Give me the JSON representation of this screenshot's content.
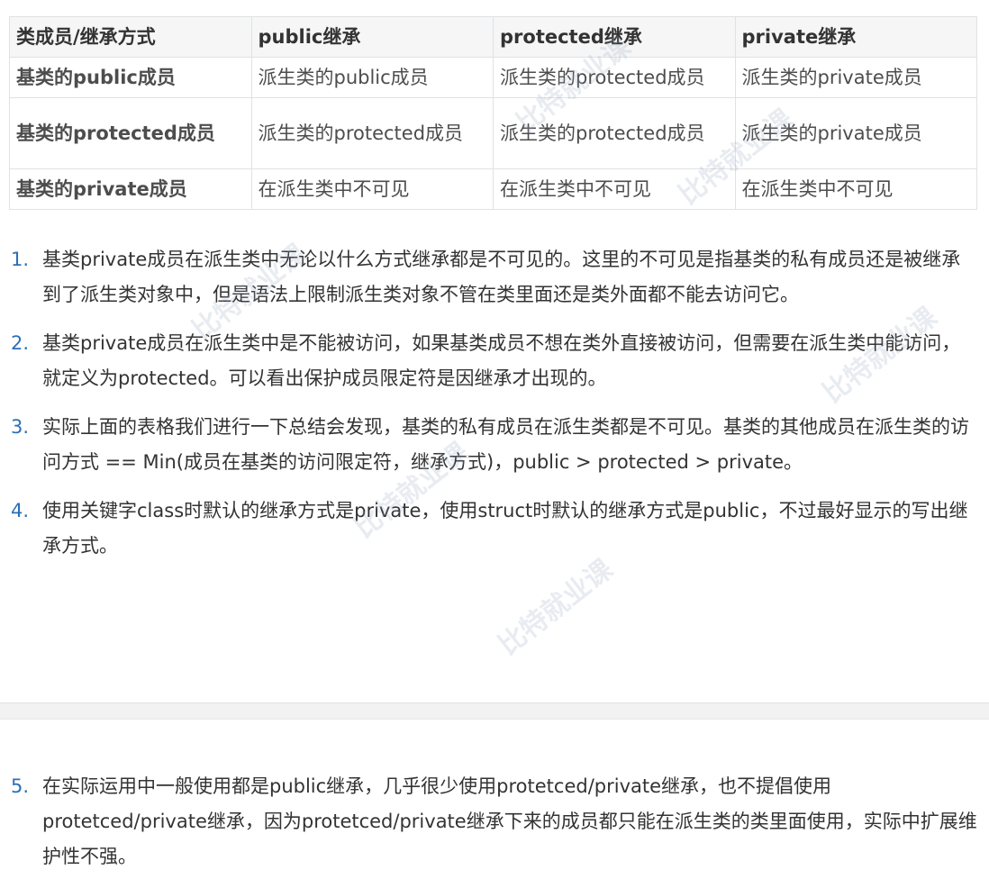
{
  "table": {
    "headers": [
      "类成员/继承方式",
      "public继承",
      "protected继承",
      "private继承"
    ],
    "rows": [
      [
        "基类的public成员",
        "派生类的public成员",
        "派生类的protected成员",
        "派生类的private成员"
      ],
      [
        "基类的protected成员",
        "派生类的protected成员",
        "派生类的protected成员",
        "派生类的private成员"
      ],
      [
        "基类的private成员",
        "在派生类中不可见",
        "在派生类中不可见",
        "在派生类中不可见"
      ]
    ]
  },
  "notes": [
    {
      "num": "1.",
      "text": "基类private成员在派生类中无论以什么方式继承都是不可见的。这里的不可见是指基类的私有成员还是被继承到了派生类对象中，但是语法上限制派生类对象不管在类里面还是类外面都不能去访问它。"
    },
    {
      "num": "2.",
      "text": "基类private成员在派生类中是不能被访问，如果基类成员不想在类外直接被访问，但需要在派生类中能访问，就定义为protected。可以看出保护成员限定符是因继承才出现的。"
    },
    {
      "num": "3.",
      "text": "实际上面的表格我们进行一下总结会发现，基类的私有成员在派生类都是不可见。基类的其他成员在派生类的访问方式 == Min(成员在基类的访问限定符，继承方式)，public  > protected > private。"
    },
    {
      "num": "4.",
      "text": "使用关键字class时默认的继承方式是private，使用struct时默认的继承方式是public，不过最好显示的写出继承方式。"
    }
  ],
  "notes2": [
    {
      "num": "5.",
      "text": "在实际运用中一般使用都是public继承，几乎很少使用protetced/private继承，也不提倡使用protetced/private继承，因为protetced/private继承下来的成员都只能在派生类的类里面使用，实际中扩展维护性不强。"
    }
  ],
  "watermark": "比特就业课",
  "colors": {
    "list_number": "#2d6fb5",
    "header_bg": "#f6f6f6",
    "border": "#dfe2e5"
  }
}
